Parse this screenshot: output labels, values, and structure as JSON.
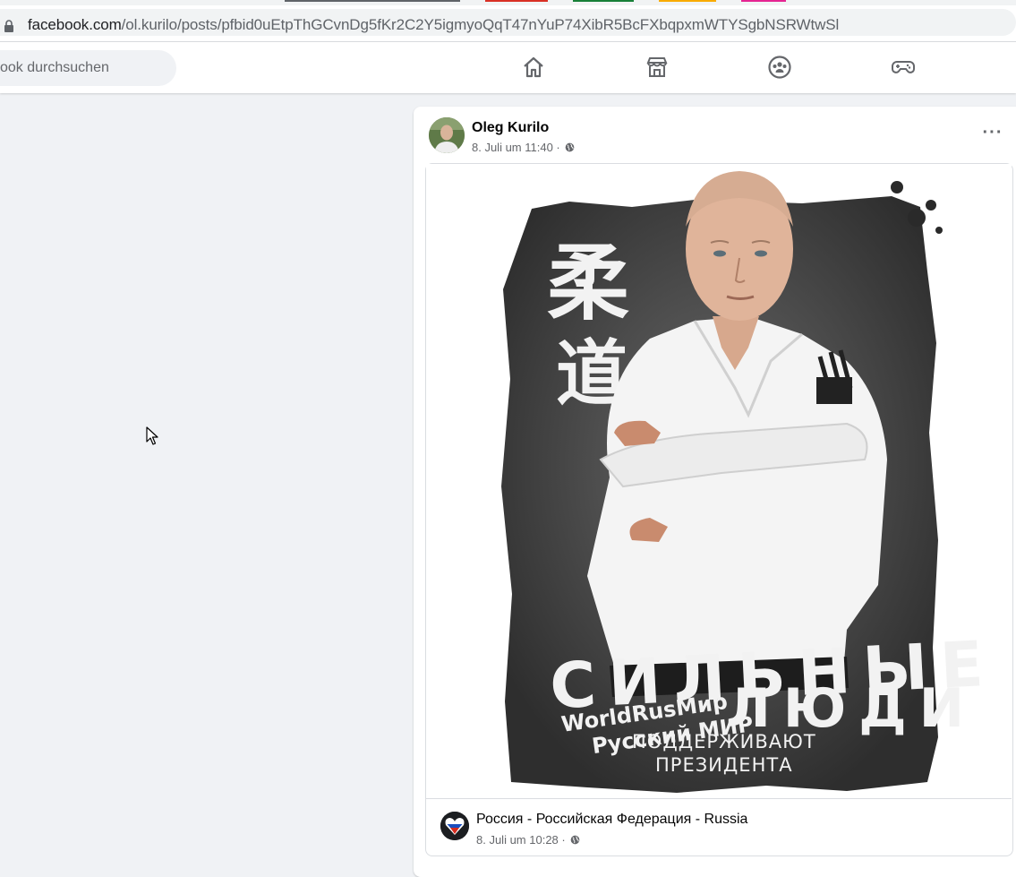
{
  "browser": {
    "url_host": "facebook.com",
    "url_path": "/ol.kurilo/posts/pfbid0uEtpThGCvnDg5fKr2C2Y5igmyoQqT47nYuP74XibR5BcFXbqpxmWTYSgbNSRWtwSl"
  },
  "header": {
    "search_placeholder": "ook durchsuchen",
    "nav": [
      "home-icon",
      "marketplace-icon",
      "groups-icon",
      "gaming-icon"
    ]
  },
  "post": {
    "author": "Oleg Kurilo",
    "timestamp": "8. Juli um 11:40 · ",
    "more_label": "···",
    "image": {
      "glyphs": [
        "柔",
        "道"
      ],
      "headline_line1": "СИЛЬНЫЕ",
      "headline_line2": "ЛЮДИ",
      "brand_line1": "WorldRusМир",
      "brand_line2": "Русский МИР",
      "sub_line1": "ПОДДЕРЖИВАЮТ",
      "sub_line2": "ПРЕЗИДЕНТА"
    },
    "shared_from": {
      "page_name": "Россия - Российская Федерация - Russia",
      "timestamp": "8. Juli um 10:28 · "
    }
  },
  "colors": {
    "fb_background": "#f0f2f5",
    "text_primary": "#050505",
    "text_secondary": "#65676b",
    "tab_colors": [
      "#5f6368",
      "#d93025",
      "#188038",
      "#f9ab00",
      "#e52592"
    ]
  }
}
